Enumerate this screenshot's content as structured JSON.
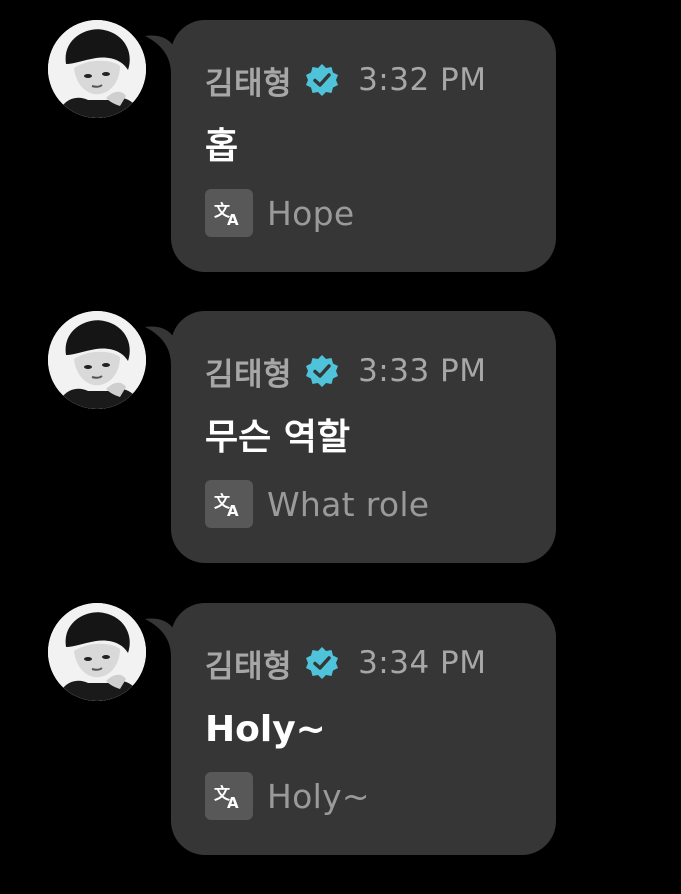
{
  "colors": {
    "background": "#000000",
    "bubble": "#363636",
    "meta_text": "#a7a7a7",
    "message_text": "#ffffff",
    "translation_text": "#9a9a9a",
    "verified_badge": "#4fc3d9",
    "translate_icon_bg": "#585858"
  },
  "icons": {
    "avatar": "avatar-photo",
    "verified": "verified-badge-icon",
    "translate": "translate-icon"
  },
  "messages": [
    {
      "sender": "김태형",
      "time": "3:32 PM",
      "text": "홉",
      "translation": "Hope"
    },
    {
      "sender": "김태형",
      "time": "3:33 PM",
      "text": "무슨 역할",
      "translation": "What role"
    },
    {
      "sender": "김태형",
      "time": "3:34 PM",
      "text": "Holy~",
      "translation": "Holy~"
    }
  ]
}
